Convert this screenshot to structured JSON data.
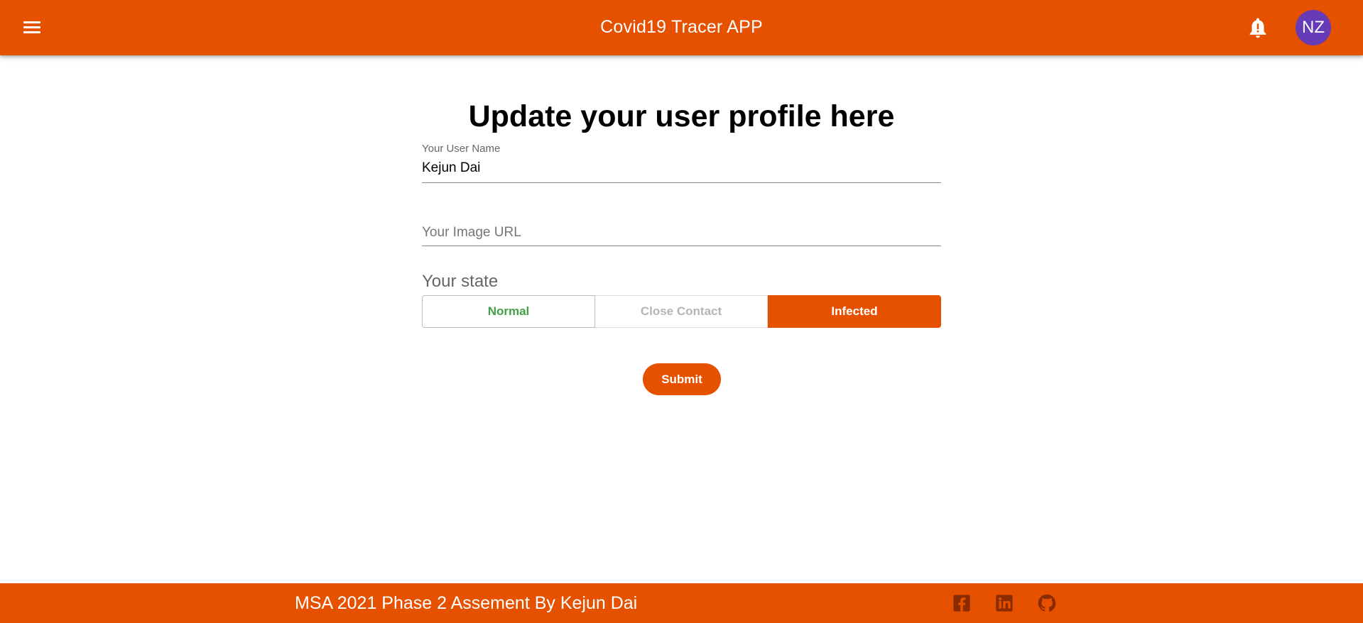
{
  "header": {
    "title": "Covid19 Tracer APP",
    "avatar_initials": "NZ",
    "icons": [
      "menu-icon",
      "bell-alert-icon"
    ]
  },
  "form": {
    "heading": "Update your user profile here",
    "username": {
      "label": "Your User Name",
      "value": "Kejun Dai"
    },
    "image_url": {
      "placeholder": "Your Image URL",
      "value": ""
    },
    "state": {
      "label": "Your state",
      "options": [
        "Normal",
        "Close Contact",
        "Infected"
      ],
      "selected": "Infected"
    },
    "submit_label": "Submit"
  },
  "footer": {
    "text": "MSA 2021 Phase 2 Assement By Kejun Dai",
    "icons": [
      "facebook-icon",
      "linkedin-icon",
      "github-icon"
    ]
  },
  "colors": {
    "primary": "#e65100",
    "avatar": "#673ab7",
    "normal_text": "#43a047",
    "social_icon": "#8c2a00"
  }
}
